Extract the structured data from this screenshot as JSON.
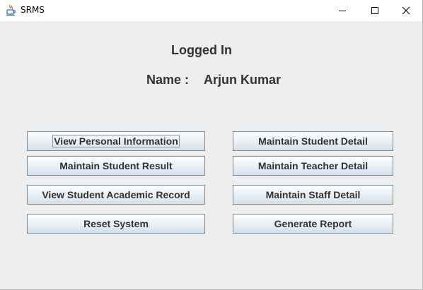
{
  "window": {
    "title": "SRMS",
    "icon": "java-cup-icon",
    "controls": {
      "minimize": "minimize-icon",
      "maximize": "maximize-icon",
      "close": "close-icon"
    }
  },
  "header": {
    "status": "Logged In",
    "name_label": "Name :",
    "name_value": "Arjun Kumar"
  },
  "buttons": {
    "view_personal_info": "View Personal Information",
    "maintain_student_result": "Maintain Student Result",
    "view_student_academic_record": "View Student Academic Record",
    "reset_system": "Reset System",
    "maintain_student_detail": "Maintain Student Detail",
    "maintain_teacher_detail": "Maintain Teacher Detail",
    "maintain_staff_detail": "Maintain Staff Detail",
    "generate_report": "Generate Report"
  },
  "colors": {
    "background": "#eeeeee",
    "text": "#333333",
    "button_border": "#7a8a99"
  }
}
